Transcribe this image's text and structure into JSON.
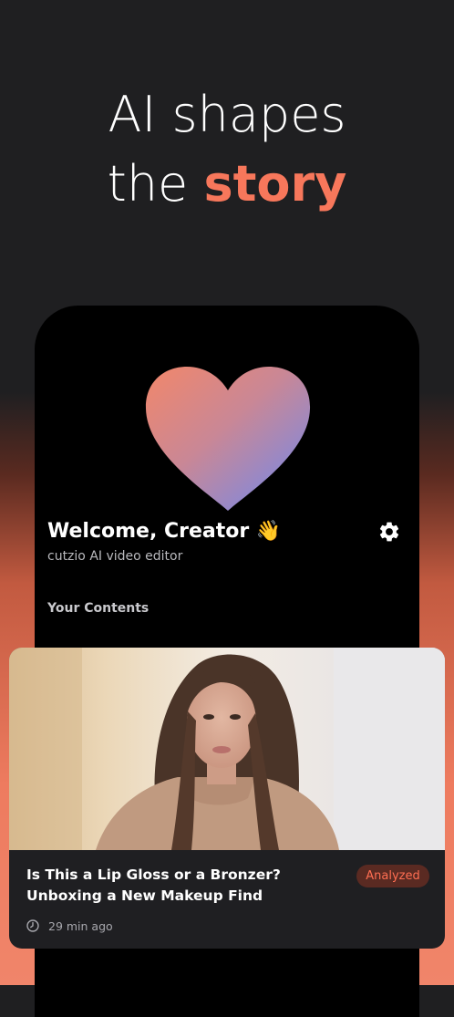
{
  "headline": {
    "line1": "AI shapes",
    "line2_plain": "the",
    "line2_accent": "story"
  },
  "profile": {
    "welcome": "Welcome, Creator 👋",
    "subtitle": "cutzio AI video editor"
  },
  "section_title": "Your Contents",
  "content_card": {
    "title": "Is This a Lip Gloss or a Bronzer? Unboxing a New Makeup Find",
    "status": "Analyzed",
    "time_ago": "29 min ago"
  },
  "colors": {
    "accent": "#f7775b",
    "badge_text": "#ff6e52",
    "card_bg": "#1f1f22"
  },
  "icons": {
    "logo": "heart-icon",
    "settings": "gear-icon",
    "time": "clock-icon"
  }
}
